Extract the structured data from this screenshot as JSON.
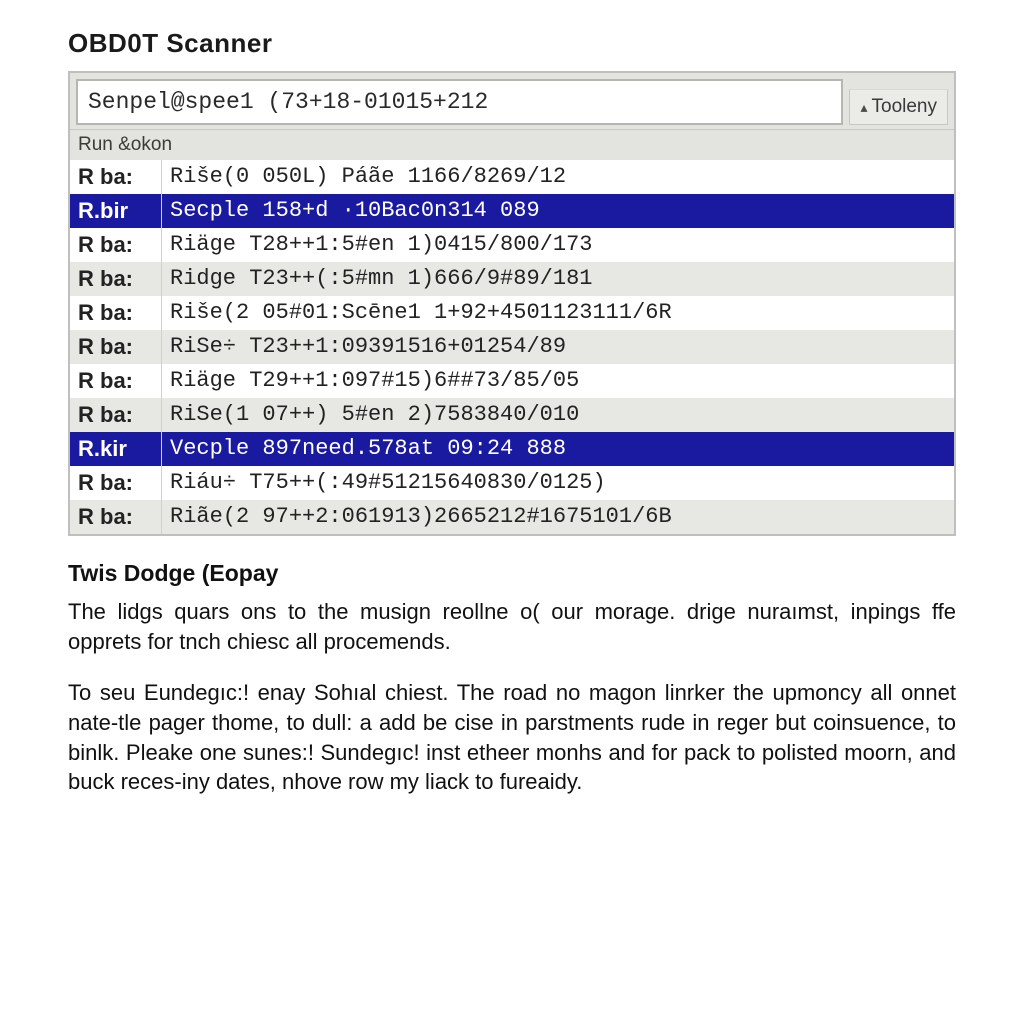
{
  "title": "OBD0T Scanner",
  "input": {
    "value": "Senpel@spee1 (73+18-01015+212"
  },
  "tooleny_label": "Tooleny",
  "sub_header": "Run &okon",
  "rows": [
    {
      "label": "R ba:",
      "value": "Riše(0 050L) Páãe 1166/8269/12",
      "variant": "plain"
    },
    {
      "label": "R.bir",
      "value": "Secple 158+d ·10Bac0n314 089",
      "variant": "sel"
    },
    {
      "label": "R ba:",
      "value": "Riäge T28++1:5#en 1)0415/800/173",
      "variant": "plain"
    },
    {
      "label": "R ba:",
      "value": "Ridge T23++(:5#mn 1)666/9#89/181",
      "variant": "alt"
    },
    {
      "label": "R ba:",
      "value": "Riše(2 05#01:Scēne1 1+92+4501123111/6R",
      "variant": "plain"
    },
    {
      "label": "R ba:",
      "value": "RiSe÷ T23++1:09391516+01254/89",
      "variant": "alt"
    },
    {
      "label": "R ba:",
      "value": "Riäge T29++1:097#15)6##73/85/05",
      "variant": "plain"
    },
    {
      "label": "R ba:",
      "value": "RiSe(1 07++) 5#en 2)7583840/010",
      "variant": "alt"
    },
    {
      "label": "R.kir",
      "value": "Vecple 897need.578at 09:24 888",
      "variant": "sel"
    },
    {
      "label": "R ba:",
      "value": "Riáu÷ T75++(:49#51215640830/0125)",
      "variant": "plain"
    },
    {
      "label": "R ba:",
      "value": "Riãe(2 97++2:061913)2665212#1675101/6B",
      "variant": "alt"
    }
  ],
  "article": {
    "heading": "Twis Dodge (Eopay",
    "p1": "The lidgs quars ons to the musign reollne o( our morage. drige nuraımst, inpings ffe opprets for tnch chiesc all procemends.",
    "p2": "To seu Eundegıc:! enay Sohıal chiest. The road no magon linrker the upmoncy all onnet nate-tle pager thome, to dull: a add be cise in parstments rude in reger but coinsuence, to binlk. Pleake one sunes:! Sundegıc! inst etheer monhs and for pack to polisted moorn, and buck reces-iny dates, nhove row my liack to fureaidy."
  }
}
